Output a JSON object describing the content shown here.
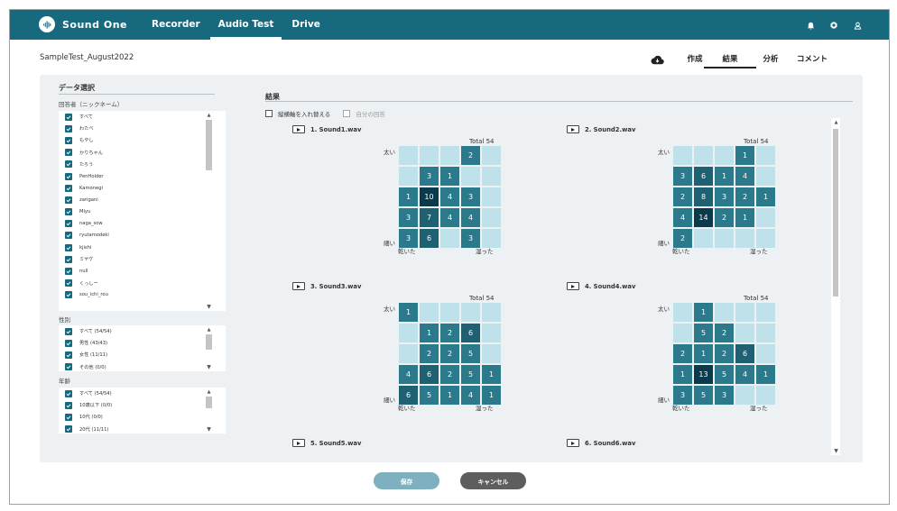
{
  "app": {
    "name": "Sound One"
  },
  "nav": [
    "Recorder",
    "Audio Test",
    "Drive"
  ],
  "nav_active": 1,
  "top_icons": [
    "bell-icon",
    "gear-icon",
    "user-icon"
  ],
  "project_title": "SampleTest_August2022",
  "header_tabs": [
    "作成",
    "結果",
    "分析",
    "コメント"
  ],
  "header_active": 1,
  "data_select": {
    "title": "データ選択",
    "respondents_label": "回答者（ニックネーム）",
    "respondents": [
      "すべて",
      "わたべ",
      "もやし",
      "かりちゃん",
      "たろう",
      "PenHolder",
      "Kamonegi",
      "zarigani",
      "Miyu",
      "naga_sow",
      "ryutamodeki",
      "kjishi",
      "ミヤケ",
      "null",
      "くっしー",
      "sou_ichi_rou"
    ],
    "gender_label": "性別",
    "genders": [
      "すべて (54/54)",
      "男性 (43/43)",
      "女性 (11/11)",
      "その他 (0/0)"
    ],
    "age_label": "年齢",
    "ages": [
      "すべて (54/54)",
      "10歳以下 (0/0)",
      "10代 (0/0)",
      "20代 (11/11)"
    ]
  },
  "results": {
    "title": "結果",
    "opt_swap_axes": "縦横軸を入れ替える",
    "opt_own_answer": "自分の回答",
    "total_label": "Total 54",
    "y_top": "太い",
    "y_bottom": "細い",
    "x_left": "乾いた",
    "x_right": "湿った",
    "sounds": [
      {
        "name": "1. Sound1.wav",
        "grid": [
          [
            0,
            0,
            0,
            2,
            0
          ],
          [
            0,
            3,
            1,
            0,
            0
          ],
          [
            1,
            10,
            4,
            3,
            0
          ],
          [
            3,
            7,
            4,
            4,
            0
          ],
          [
            3,
            6,
            0,
            3,
            0
          ]
        ]
      },
      {
        "name": "2. Sound2.wav",
        "grid": [
          [
            0,
            0,
            0,
            1,
            0
          ],
          [
            3,
            6,
            1,
            4,
            0
          ],
          [
            2,
            8,
            3,
            2,
            1
          ],
          [
            4,
            14,
            2,
            1,
            0
          ],
          [
            2,
            0,
            0,
            0,
            0
          ]
        ]
      },
      {
        "name": "3. Sound3.wav",
        "grid": [
          [
            1,
            0,
            0,
            0,
            0
          ],
          [
            0,
            1,
            2,
            6,
            0
          ],
          [
            0,
            2,
            2,
            5,
            0
          ],
          [
            4,
            6,
            2,
            5,
            1
          ],
          [
            6,
            5,
            1,
            4,
            1
          ]
        ]
      },
      {
        "name": "4. Sound4.wav",
        "grid": [
          [
            0,
            1,
            0,
            0,
            0
          ],
          [
            0,
            5,
            2,
            0,
            0
          ],
          [
            2,
            1,
            2,
            6,
            0
          ],
          [
            1,
            13,
            5,
            4,
            1
          ],
          [
            3,
            5,
            3,
            0,
            0
          ]
        ]
      },
      {
        "name": "5. Sound5.wav"
      },
      {
        "name": "6. Sound6.wav"
      }
    ]
  },
  "colors": {
    "empty": "#bfe2ea",
    "low": "#2b7a8c",
    "mid": "#1e6173",
    "high": "#0a3b4c",
    "brand": "#17697d"
  },
  "buttons": {
    "save": "保存",
    "cancel": "キャンセル"
  }
}
